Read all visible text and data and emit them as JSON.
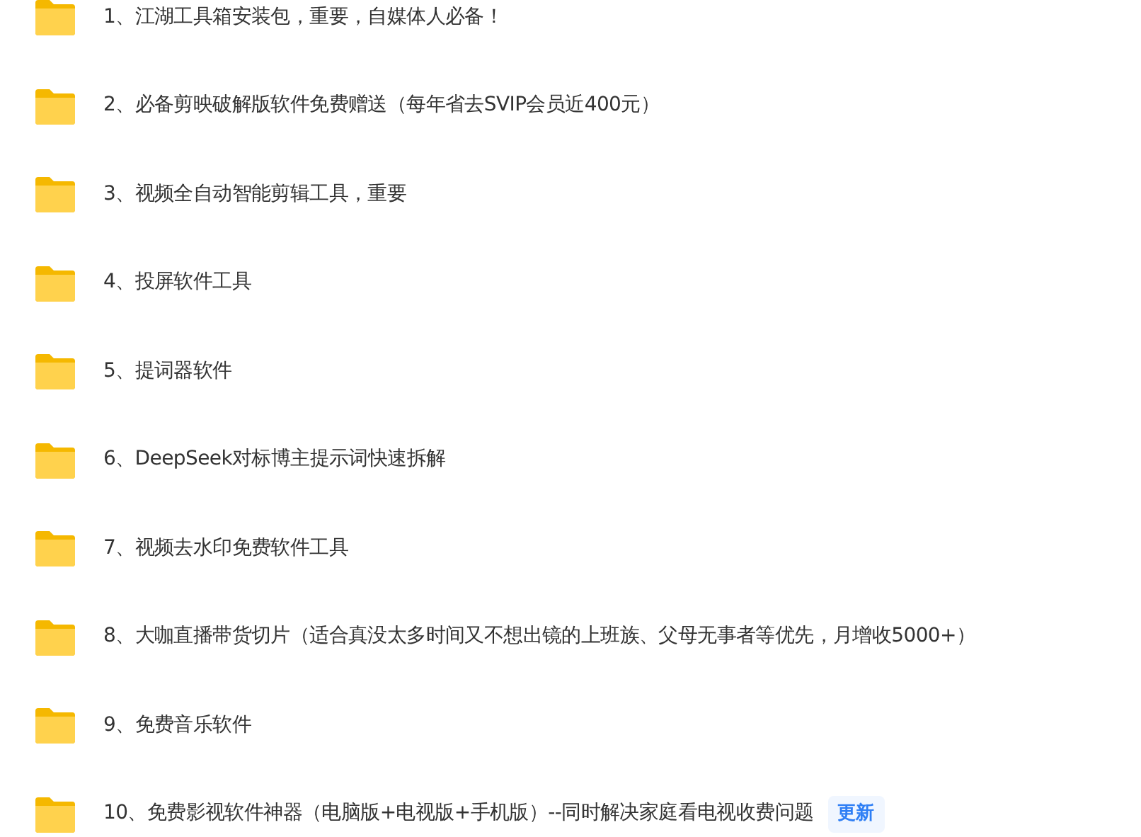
{
  "folders": [
    {
      "name": "1、江湖工具箱安装包，重要，自媒体人必备！"
    },
    {
      "name": "2、必备剪映破解版软件免费赠送（每年省去SVIP会员近400元）"
    },
    {
      "name": "3、视频全自动智能剪辑工具，重要"
    },
    {
      "name": "4、投屏软件工具"
    },
    {
      "name": "5、提词器软件"
    },
    {
      "name": "6、DeepSeek对标博主提示词快速拆解"
    },
    {
      "name": "7、视频去水印免费软件工具"
    },
    {
      "name": "8、大咖直播带货切片（适合真没太多时间又不想出镜的上班族、父母无事者等优先，月增收5000+）"
    },
    {
      "name": "9、免费音乐软件"
    },
    {
      "name": "10、免费影视软件神器（电脑版+电视版+手机版）--同时解决家庭看电视收费问题",
      "badge": "更新"
    }
  ]
}
